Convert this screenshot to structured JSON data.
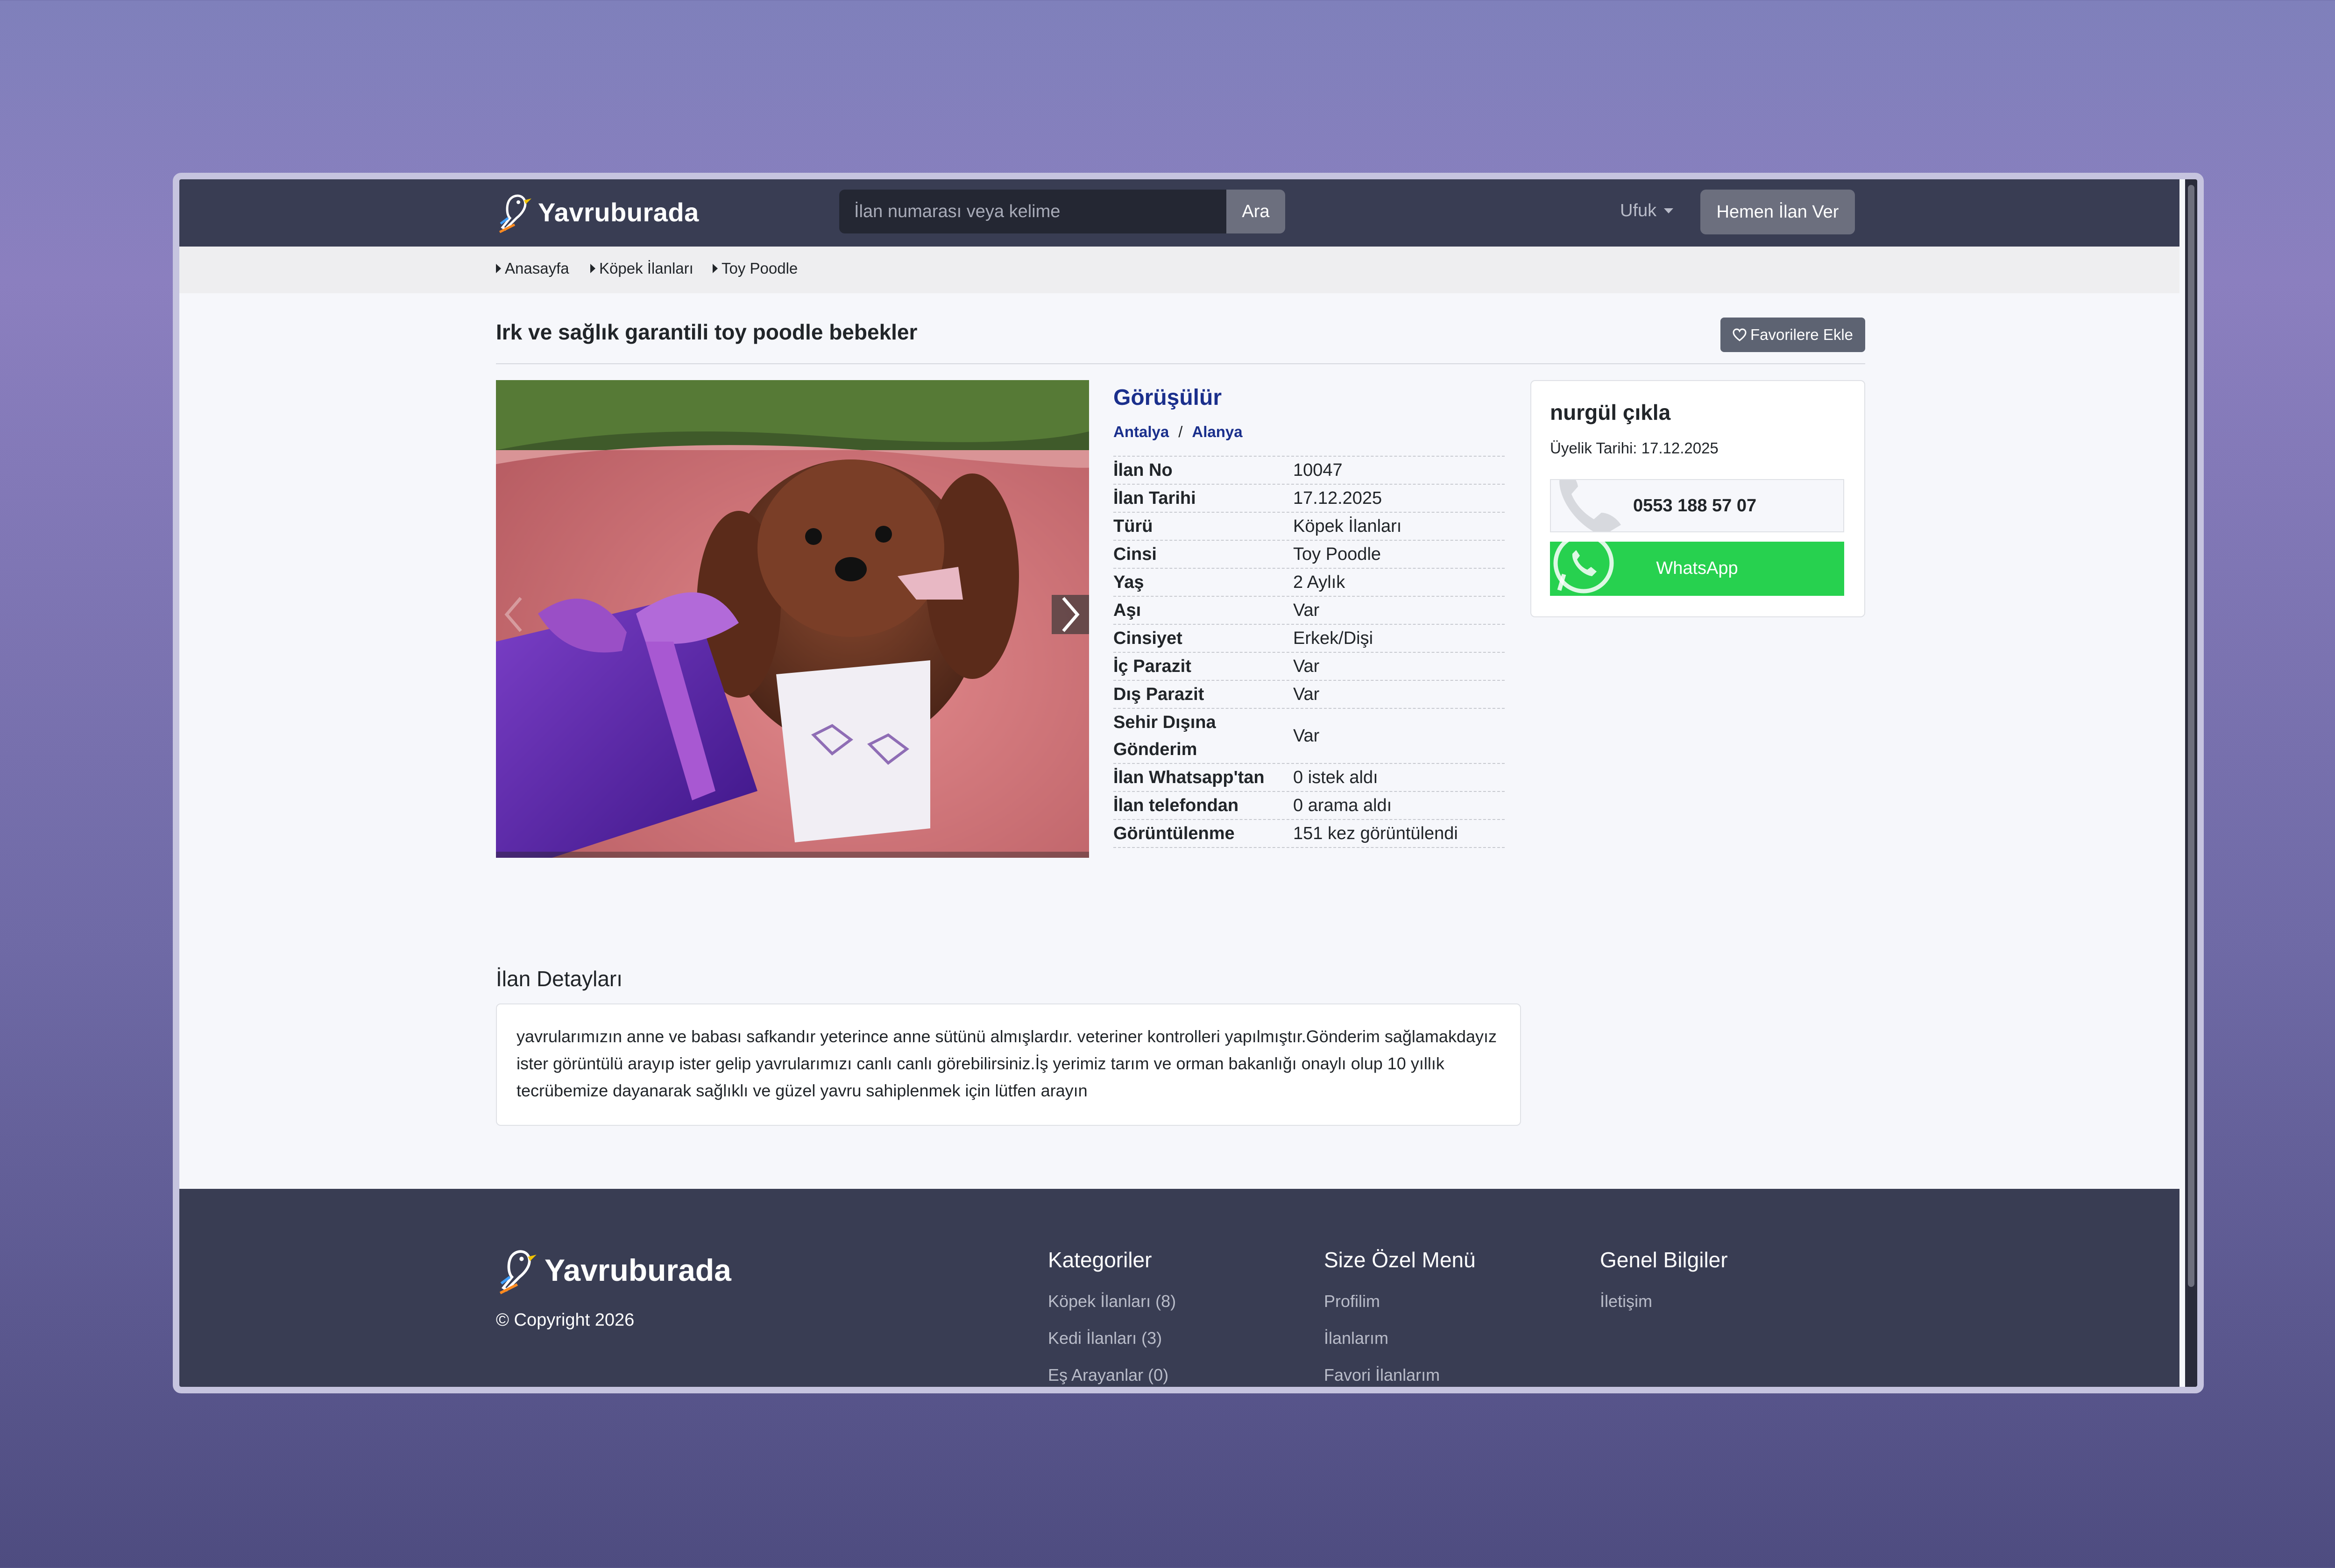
{
  "header": {
    "brand": "Yavruburada",
    "search_placeholder": "İlan numarası veya kelime",
    "search_button": "Ara",
    "user_menu": "Ufuk",
    "post_button": "Hemen İlan Ver"
  },
  "breadcrumb": [
    "Anasayfa",
    "Köpek İlanları",
    "Toy Poodle"
  ],
  "listing": {
    "title": "Irk ve sağlık garantili toy poodle bebekler",
    "favorite_button": "Favorilere Ekle",
    "price": "Görüşülür",
    "city": "Antalya",
    "district": "Alanya",
    "location_separator": "/",
    "specs": [
      {
        "label": "İlan No",
        "value": "10047"
      },
      {
        "label": "İlan Tarihi",
        "value": "17.12.2025"
      },
      {
        "label": "Türü",
        "value": "Köpek İlanları"
      },
      {
        "label": "Cinsi",
        "value": "Toy Poodle"
      },
      {
        "label": "Yaş",
        "value": "2 Aylık"
      },
      {
        "label": "Aşı",
        "value": "Var"
      },
      {
        "label": "Cinsiyet",
        "value": "Erkek/Dişi"
      },
      {
        "label": "İç Parazit",
        "value": "Var"
      },
      {
        "label": "Dış Parazit",
        "value": "Var"
      },
      {
        "label": "Sehir Dışına Gönderim",
        "value": "Var"
      },
      {
        "label": "İlan Whatsapp'tan",
        "value": "0 istek aldı"
      },
      {
        "label": "İlan telefondan",
        "value": "0 arama aldı"
      },
      {
        "label": "Görüntülenme",
        "value": "151 kez görüntülendi"
      }
    ],
    "details_title": "İlan Detayları",
    "details_text": "yavrularımızın anne ve babası safkandır yeterince anne sütünü almışlardır. veteriner kontrolleri yapılmıştır.Gönderim sağlamakdayız ister görüntülü arayıp ister gelip yavrularımızı canlı canlı görebilirsiniz.İş yerimiz tarım ve orman bakanlığı onaylı olup 10 yıllık tecrübemize dayanarak sağlıklı ve güzel yavru sahiplenmek için lütfen arayın"
  },
  "seller": {
    "name": "nurgül çıkla",
    "member_since": "Üyelik Tarihi: 17.12.2025",
    "phone": "0553 188 57 07",
    "whatsapp_label": "WhatsApp"
  },
  "footer": {
    "brand": "Yavruburada",
    "copyright": "© Copyright 2026",
    "columns": [
      {
        "title": "Kategoriler",
        "links": [
          "Köpek İlanları (8)",
          "Kedi İlanları (3)",
          "Eş Arayanlar (0)"
        ]
      },
      {
        "title": "Size Özel Menü",
        "links": [
          "Profilim",
          "İlanlarım",
          "Favori İlanlarım"
        ]
      },
      {
        "title": "Genel Bilgiler",
        "links": [
          "İletişim"
        ]
      }
    ]
  },
  "colors": {
    "header_bg": "#393d53",
    "accent_blue": "#1a2f8c",
    "whatsapp_green": "#27d14f",
    "button_gray": "#6c6f7e"
  }
}
